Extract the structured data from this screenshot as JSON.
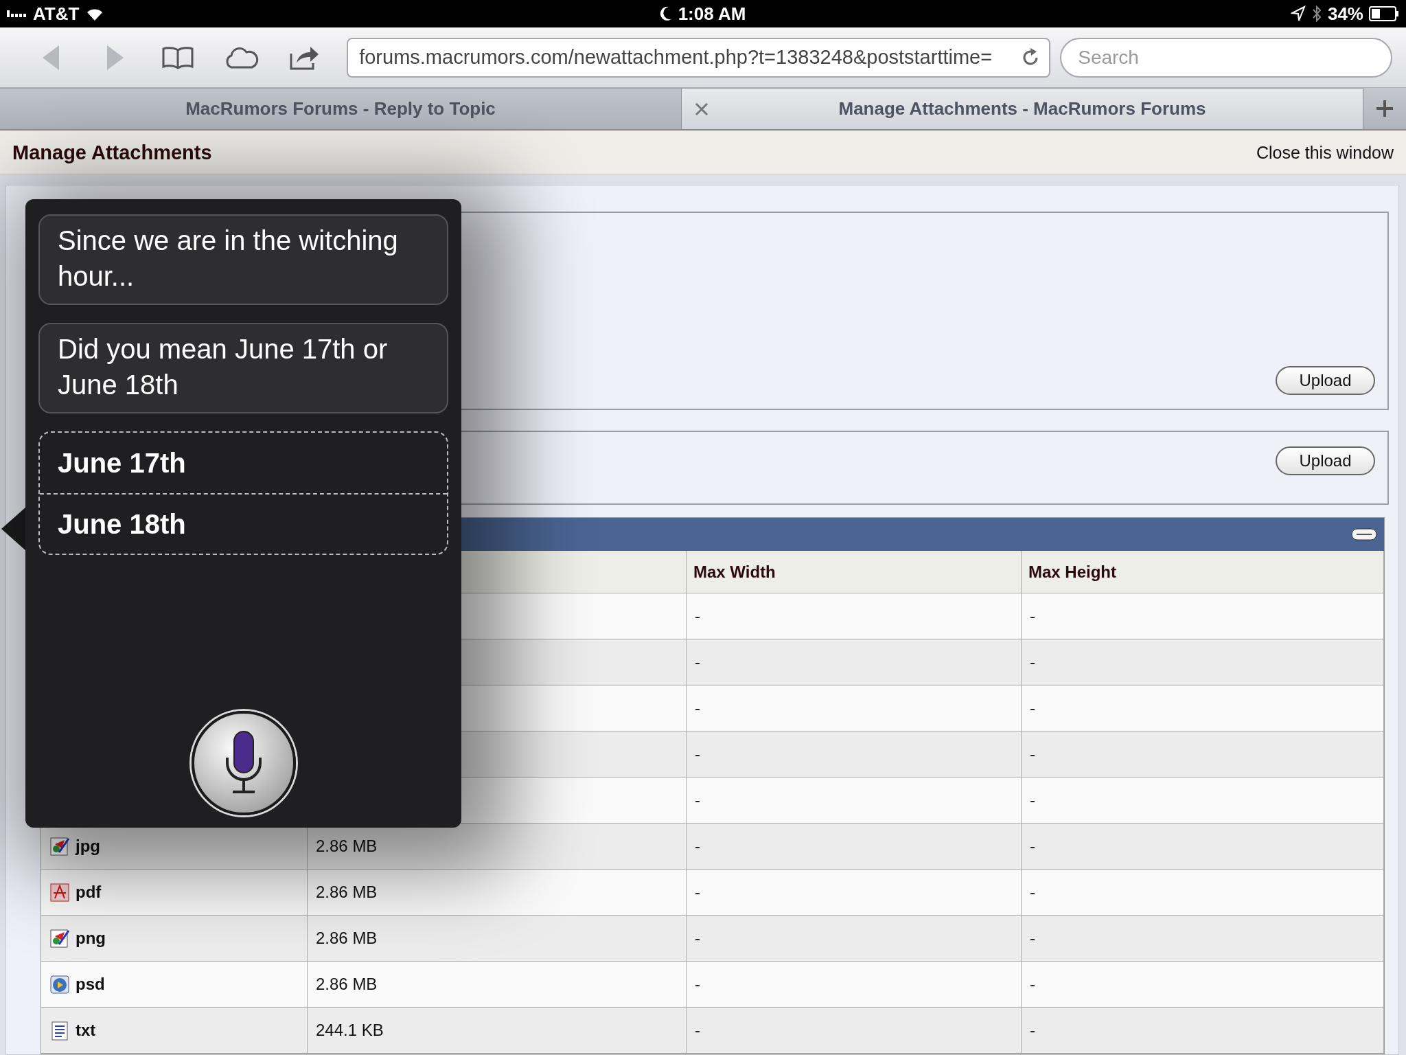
{
  "status_bar": {
    "carrier": "AT&T",
    "time": "1:08 AM",
    "battery": "34%"
  },
  "nav_buttons": [
    {
      "kind": "back",
      "disabled": true
    },
    {
      "kind": "forward",
      "disabled": true
    }
  ],
  "address": {
    "value": "forums.macrumors.com/newattachment.php?t=1383248&poststarttime="
  },
  "search": {
    "placeholder": "Search"
  },
  "tabs": [
    {
      "label": "MacRumors Forums - Reply to Topic",
      "selected": false
    },
    {
      "label": "Manage Attachments - MacRumors Forums",
      "selected": true
    }
  ],
  "page": {
    "title": "Manage Attachments",
    "close_link": "Close this window"
  },
  "upload_computer": {
    "button": "Upload"
  },
  "upload_url": {
    "button": "Upload"
  },
  "attachment_key": {
    "columns": {
      "column_3": "Max Width",
      "column_4": "Max Height"
    },
    "rows": [
      {
        "max_width": "-",
        "max_height": "-"
      },
      {
        "max_width": "-",
        "max_height": "-"
      },
      {
        "max_width": "-",
        "max_height": "-"
      },
      {
        "max_width": "-",
        "max_height": "-"
      },
      {
        "max_width": "-",
        "max_height": "-"
      },
      {
        "kind": "image",
        "filetype": "jpg",
        "max_filesize": "2.86 MB",
        "max_width": "-",
        "max_height": "-"
      },
      {
        "kind": "pdf",
        "filetype": "pdf",
        "max_filesize": "2.86 MB",
        "max_width": "-",
        "max_height": "-"
      },
      {
        "kind": "image",
        "filetype": "png",
        "max_filesize": "2.86 MB",
        "max_width": "-",
        "max_height": "-"
      },
      {
        "kind": "photoshop",
        "filetype": "psd",
        "max_filesize": "2.86 MB",
        "max_width": "-",
        "max_height": "-"
      },
      {
        "kind": "text",
        "filetype": "txt",
        "max_filesize": "244.1 KB",
        "max_width": "-",
        "max_height": "-"
      }
    ]
  },
  "siri": {
    "messages": [
      "Since we are in the witching hour...",
      "Did you mean June 17th or June 18th"
    ],
    "options": [
      {
        "label": "June 17th"
      },
      {
        "label": "June 18th"
      }
    ]
  }
}
